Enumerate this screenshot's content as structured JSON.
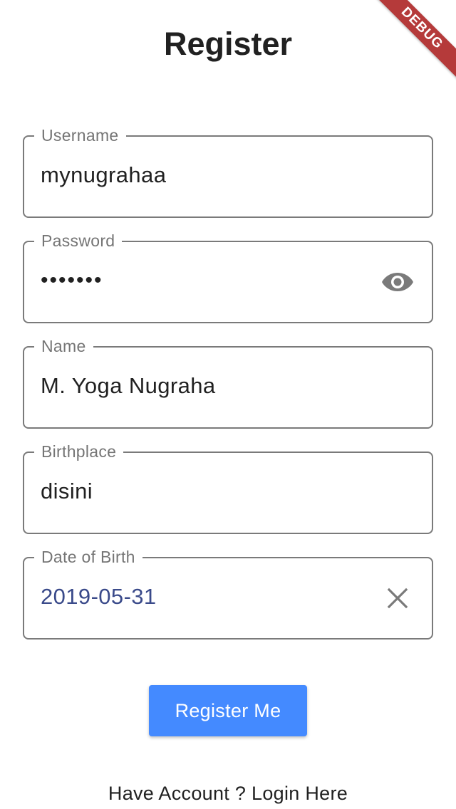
{
  "page": {
    "title": "Register"
  },
  "debug_banner": {
    "label": "DEBUG",
    "color": "#b53a3a"
  },
  "form": {
    "username": {
      "label": "Username",
      "value": "mynugrahaa"
    },
    "password": {
      "label": "Password",
      "value": "•••••••",
      "toggle_icon": "eye-icon"
    },
    "name": {
      "label": "Name",
      "value": "M. Yoga Nugraha"
    },
    "birthplace": {
      "label": "Birthplace",
      "value": "disini"
    },
    "date_of_birth": {
      "label": "Date of Birth",
      "value": "2019-05-31",
      "clear_icon": "close-icon"
    }
  },
  "actions": {
    "register_label": "Register Me",
    "login_link": "Have Account ? Login Here"
  },
  "colors": {
    "accent": "#448aff",
    "border": "#7a7a7a",
    "date_text": "#3a4a8a"
  }
}
